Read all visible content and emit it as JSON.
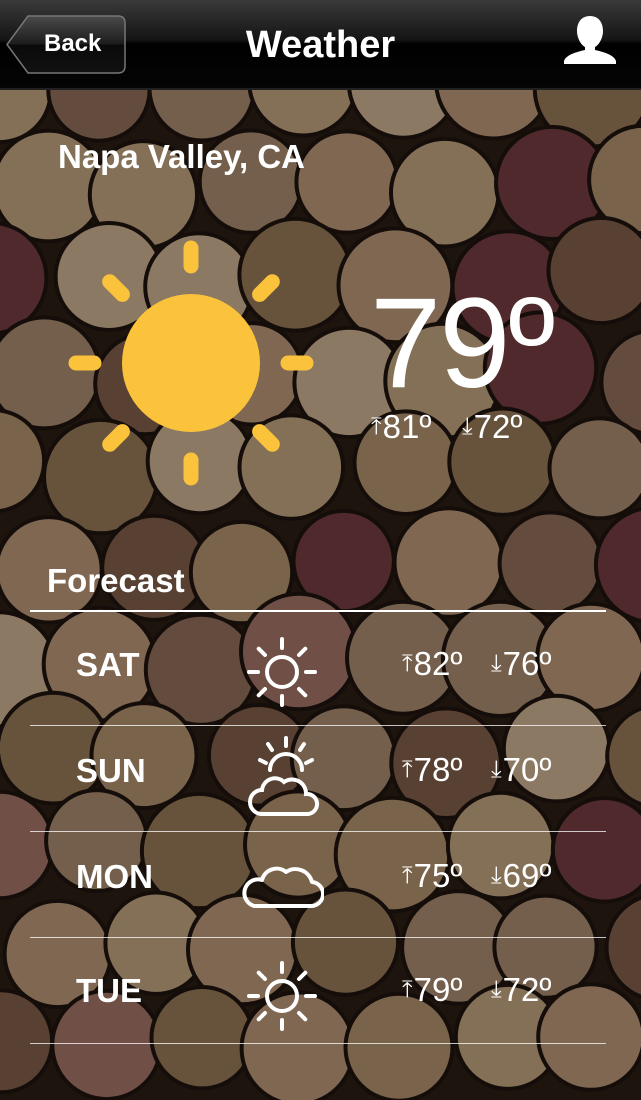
{
  "nav": {
    "back_label": "Back",
    "title": "Weather",
    "profile_icon": "user-silhouette-icon"
  },
  "current": {
    "location": "Napa Valley, CA",
    "condition_icon": "sun-icon",
    "temperature": "79º",
    "high": "81º",
    "low": "72º",
    "high_arrow": "⤒",
    "low_arrow": "⤓"
  },
  "forecast": {
    "heading": "Forecast",
    "days": [
      {
        "day": "SAT",
        "icon": "sun-icon",
        "high": "82º",
        "low": "76º"
      },
      {
        "day": "SUN",
        "icon": "partly-cloudy-icon",
        "high": "78º",
        "low": "70º"
      },
      {
        "day": "MON",
        "icon": "cloud-icon",
        "high": "75º",
        "low": "69º"
      },
      {
        "day": "TUE",
        "icon": "sun-icon",
        "high": "79º",
        "low": "72º"
      }
    ]
  },
  "colors": {
    "sun": "#FBC33C",
    "text": "#FFFFFF",
    "navbar": "#000000"
  }
}
